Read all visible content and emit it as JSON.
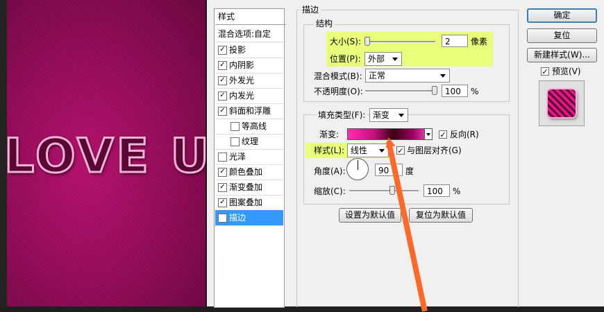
{
  "canvas": {
    "art_text": "LOVE U"
  },
  "styles_panel": {
    "title": "样式",
    "blend_options": "混合选项:自定",
    "items": [
      {
        "label": "投影",
        "checked": true
      },
      {
        "label": "内阴影",
        "checked": true
      },
      {
        "label": "外发光",
        "checked": true
      },
      {
        "label": "内发光",
        "checked": true
      },
      {
        "label": "斜面和浮雕",
        "checked": true
      },
      {
        "label": "等高线",
        "checked": false
      },
      {
        "label": "纹理",
        "checked": false
      },
      {
        "label": "光泽",
        "checked": false
      },
      {
        "label": "颜色叠加",
        "checked": true
      },
      {
        "label": "渐变叠加",
        "checked": true
      },
      {
        "label": "图案叠加",
        "checked": true
      },
      {
        "label": "描边",
        "checked": true
      }
    ]
  },
  "stroke": {
    "group_title": "描边",
    "structure_title": "结构",
    "size_label": "大小(S):",
    "size_value": "2",
    "size_unit": "像素",
    "position_label": "位置(P):",
    "position_value": "外部",
    "blend_mode_label": "混合模式(B):",
    "blend_mode_value": "正常",
    "opacity_label": "不透明度(O):",
    "opacity_value": "100",
    "opacity_unit": "%",
    "fill_type_label": "填充类型(F):",
    "fill_type_value": "渐变",
    "gradient_label": "渐变:",
    "reverse_label": "反向(R)",
    "reverse_checked": true,
    "style_label": "样式(L):",
    "style_value": "线性",
    "align_label": "与图层对齐(G)",
    "align_checked": true,
    "angle_label": "角度(A):",
    "angle_value": "90",
    "angle_unit": "度",
    "scale_label": "缩放(C):",
    "scale_value": "100",
    "scale_unit": "%",
    "set_default_btn": "设置为默认值",
    "reset_default_btn": "复位为默认值"
  },
  "buttons": {
    "ok": "确定",
    "reset": "复位",
    "new_style": "新建样式(W)...",
    "preview_label": "预览(V)",
    "preview_checked": true
  },
  "colors": {
    "highlight": "#eaff7a",
    "selection": "#3399ff",
    "arrow": "#ff6a2a",
    "canvas_bg": "#9a0b5c"
  }
}
